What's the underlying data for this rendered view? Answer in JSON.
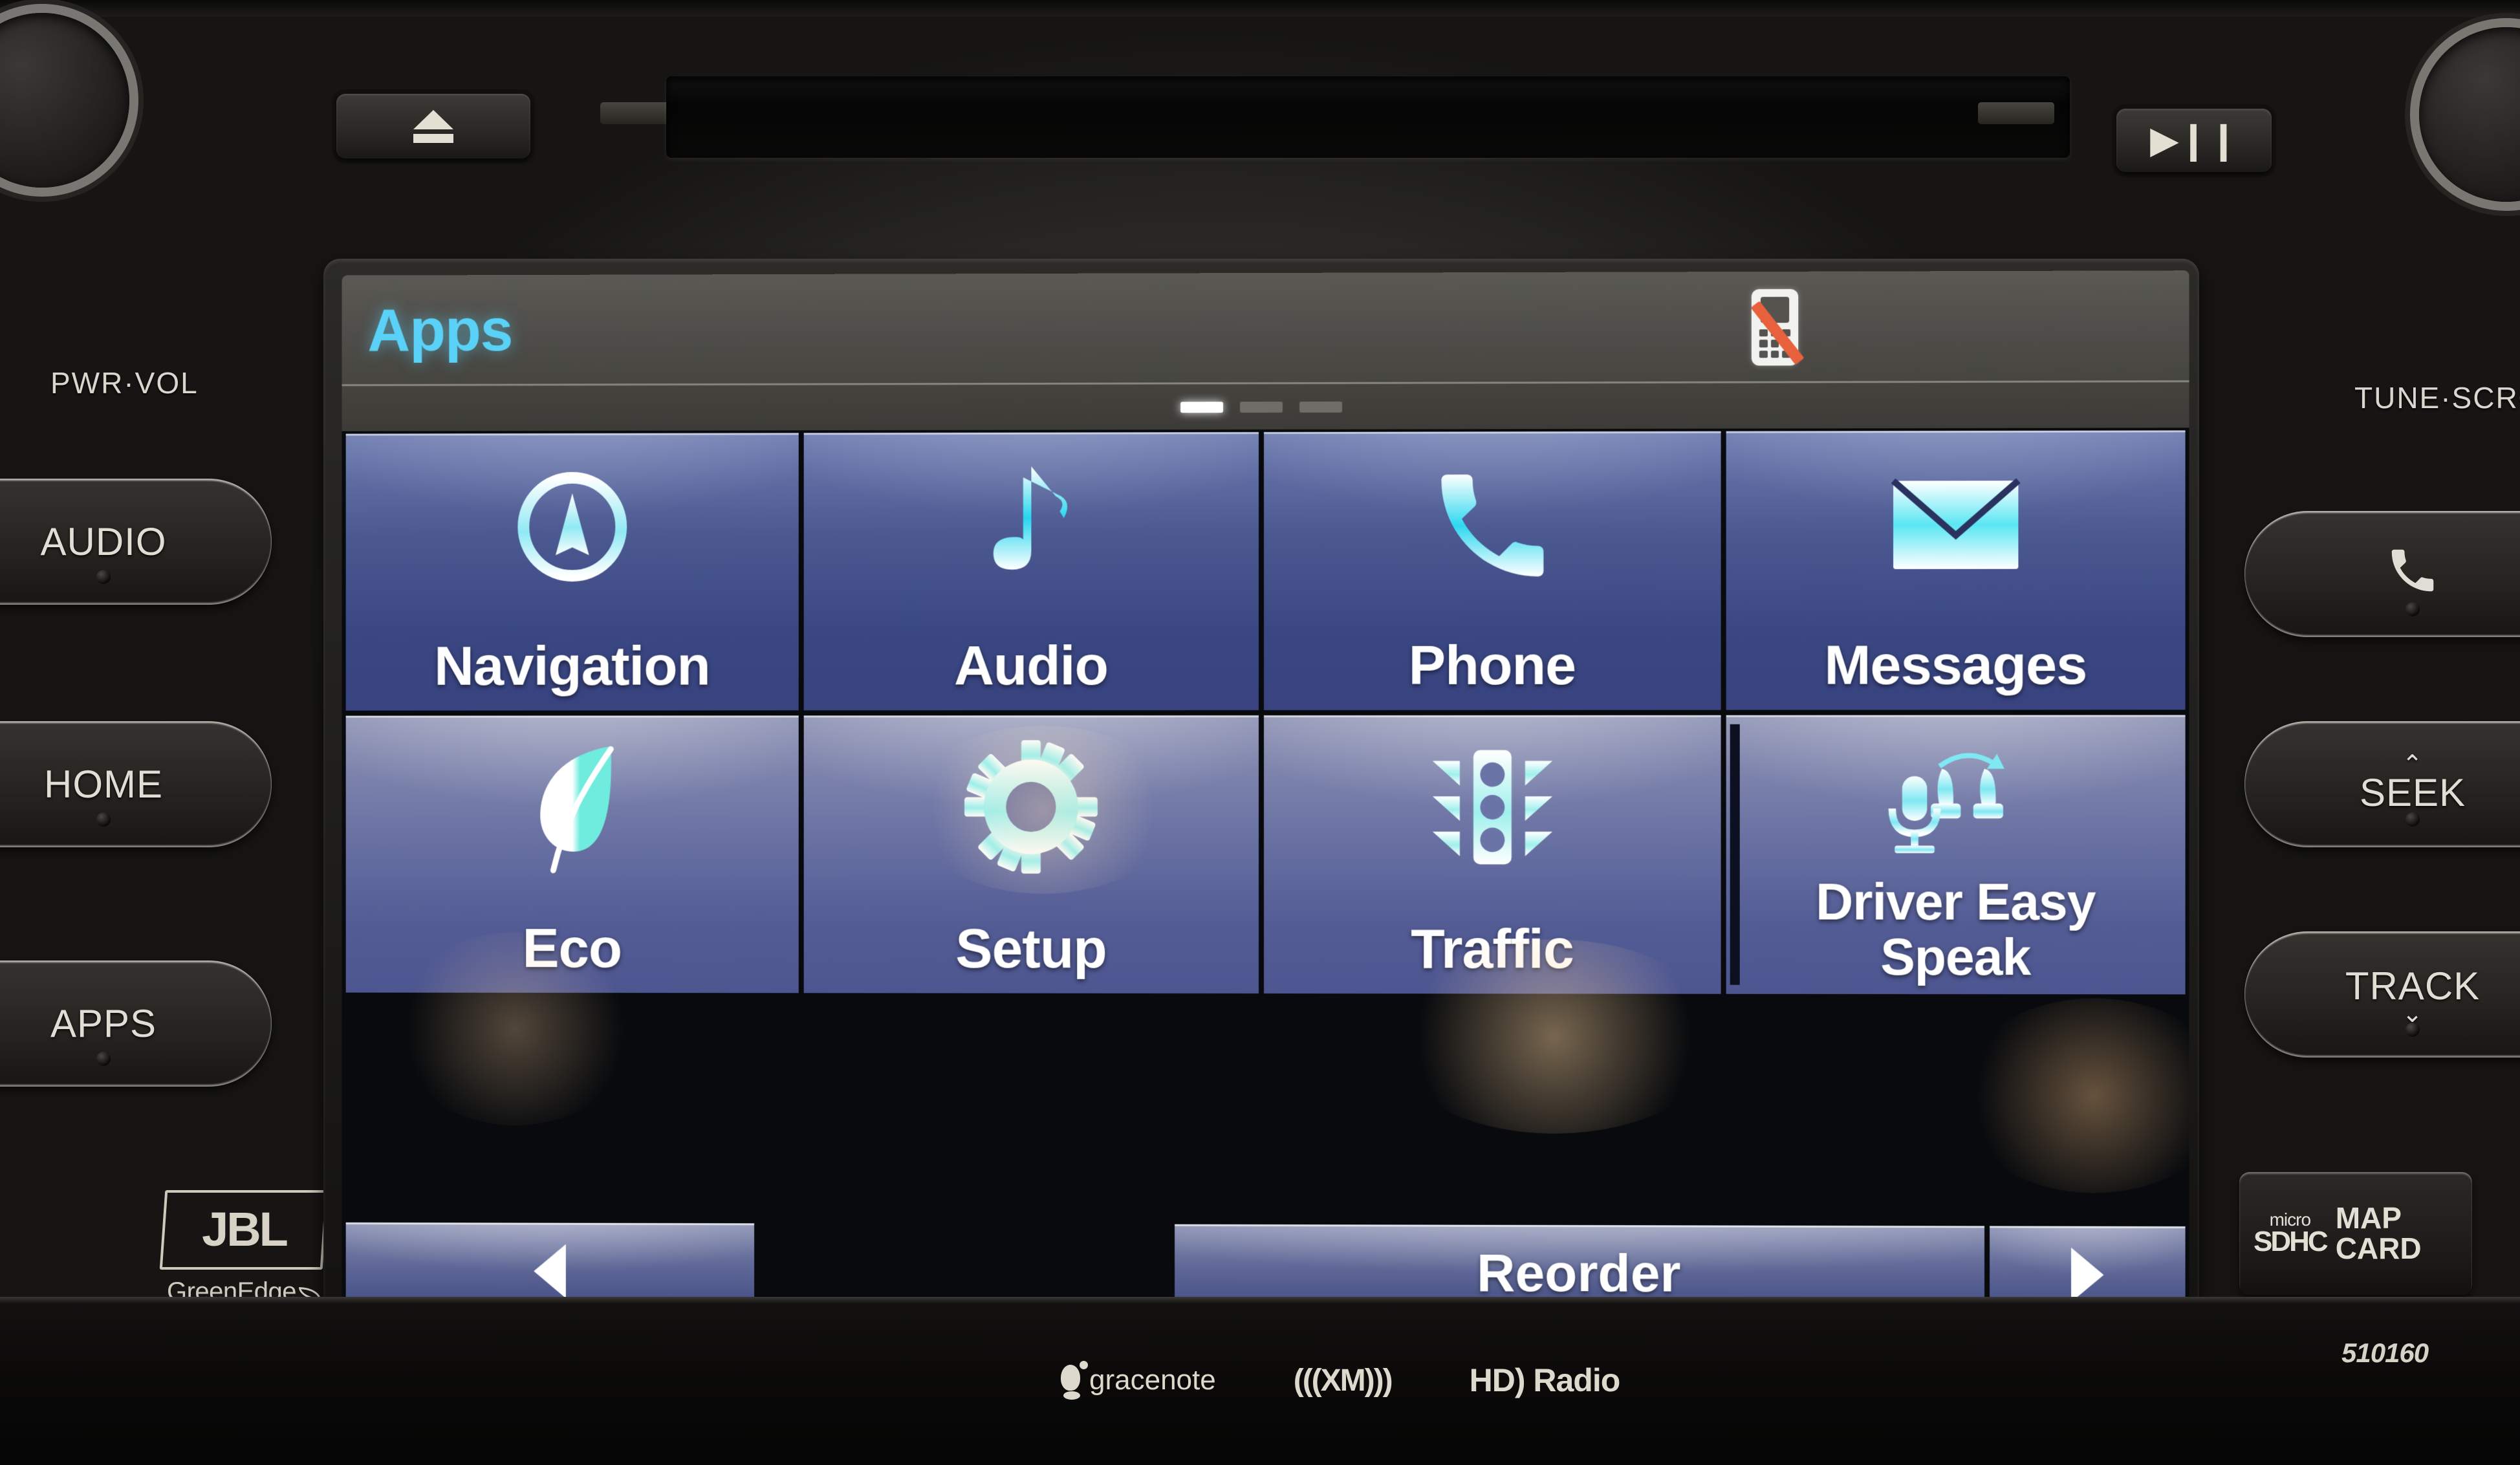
{
  "screen": {
    "title": "Apps",
    "status_icons": [
      {
        "name": "no-phone-connected",
        "label": ""
      }
    ],
    "page_indicator": {
      "total": 3,
      "active_index": 0
    },
    "apps": [
      {
        "label": "Navigation",
        "icon": "compass-icon"
      },
      {
        "label": "Audio",
        "icon": "music-note-icon"
      },
      {
        "label": "Phone",
        "icon": "phone-handset-icon"
      },
      {
        "label": "Messages",
        "icon": "envelope-icon"
      },
      {
        "label": "Eco",
        "icon": "leaf-icon"
      },
      {
        "label": "Setup",
        "icon": "gear-icon"
      },
      {
        "label": "Traffic",
        "icon": "traffic-light-icon"
      },
      {
        "label": "Driver Easy Speak",
        "icon": "microphone-seats-icon",
        "line1": "Driver Easy",
        "line2": "Speak"
      }
    ],
    "bottom_bar": {
      "prev_label": "◀",
      "reorder_label": "Reorder",
      "next_label": "▶"
    },
    "colors": {
      "title_accent": "#5ad2f7",
      "tile_blue": "#4b5890",
      "tile_blue_light": "#6c74a4",
      "icon_cyan": "#7fe8f2",
      "alert_red": "#e8603c"
    }
  },
  "hardware": {
    "knobs": [
      {
        "label": "PWR·VOL"
      },
      {
        "label": "TUNE·SCROLL"
      }
    ],
    "left_buttons": [
      {
        "label": "AUDIO"
      },
      {
        "label": "HOME"
      },
      {
        "label": "APPS"
      }
    ],
    "right_buttons": [
      {
        "label": "",
        "icon": "phone-handset-icon"
      },
      {
        "label": "SEEK",
        "chevron": "⌃"
      },
      {
        "label": "TRACK",
        "chevron": "⌄"
      }
    ],
    "top_buttons": [
      {
        "label": "",
        "icon": "eject-icon"
      },
      {
        "label": "▶❙❙",
        "icon": "play-pause-icon"
      }
    ],
    "map_card": {
      "sd_micro": "micro",
      "sd_type": "SDHC",
      "label_line1": "MAP",
      "label_line2": "CARD"
    },
    "jbl_badge": {
      "brand": "JBL",
      "sub": "GreenEdge"
    },
    "brand_strip": [
      {
        "name": "gracenote",
        "text": "gracenote"
      },
      {
        "name": "siriusxm",
        "text": "(((XM)))"
      },
      {
        "name": "hd-radio",
        "text": "HD) Radio"
      }
    ],
    "serial": "510160"
  }
}
